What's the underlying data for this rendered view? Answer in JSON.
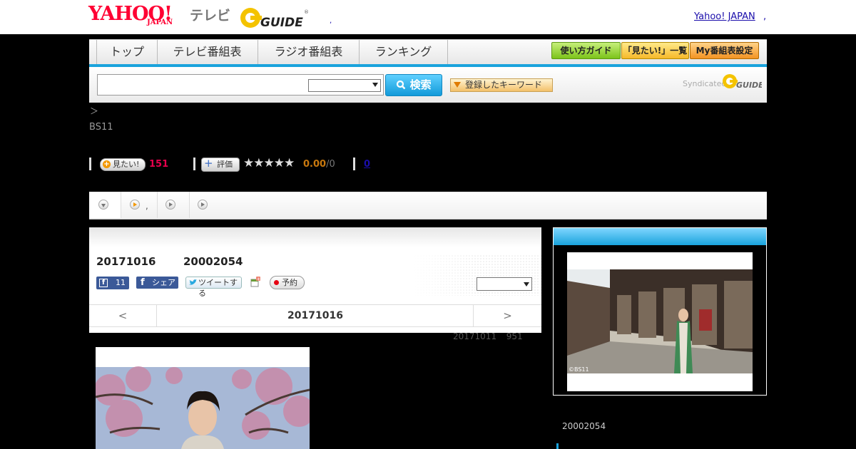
{
  "header": {
    "logo_text": "YAHOO!",
    "logo_sub": "JAPAN",
    "tv_label": "テレビ",
    "gguide_text": "GUIDE",
    "yahoo_link": "Yahoo! JAPAN",
    "link_dot": ",",
    "small_mark": ","
  },
  "nav": {
    "tabs": [
      "トップ",
      "テレビ番組表",
      "ラジオ番組表",
      "ランキング"
    ],
    "buttons": [
      "使い方ガイド",
      "「見たい!」一覧",
      "My番組表設定"
    ],
    "accent_color": "#1aa3dc",
    "button_color": "#f6c94a"
  },
  "search": {
    "input_value": "",
    "select_value": "",
    "button_label": "検索",
    "keyword_button_label": "登録したキーワード",
    "syndicated_label": "Syndicated",
    "syndicated_logo": "GUIDE"
  },
  "breadcrumb": "＞",
  "channel": "BS11",
  "stats": {
    "want_label": "見たい!",
    "want_count": "151",
    "rate_label": "評価",
    "stars": "★★★★★",
    "rating": "0.00",
    "rating_suffix": "/0",
    "review_count": "0"
  },
  "tabbar": {
    "tab2_suffix": ","
  },
  "program": {
    "date_code": "20171016",
    "program_id": "20002054",
    "fb_count": "11",
    "fb_share_label": "シェア",
    "tweet_label": "ツイートする",
    "reserve_label": "予約",
    "select_value": "",
    "prev_label": "<",
    "next_label": ">",
    "nav_date": "20171016",
    "meta_date": "20171011",
    "meta_count": "951"
  },
  "sidebar": {
    "credit": "©BS11",
    "program_id": "20002054"
  }
}
